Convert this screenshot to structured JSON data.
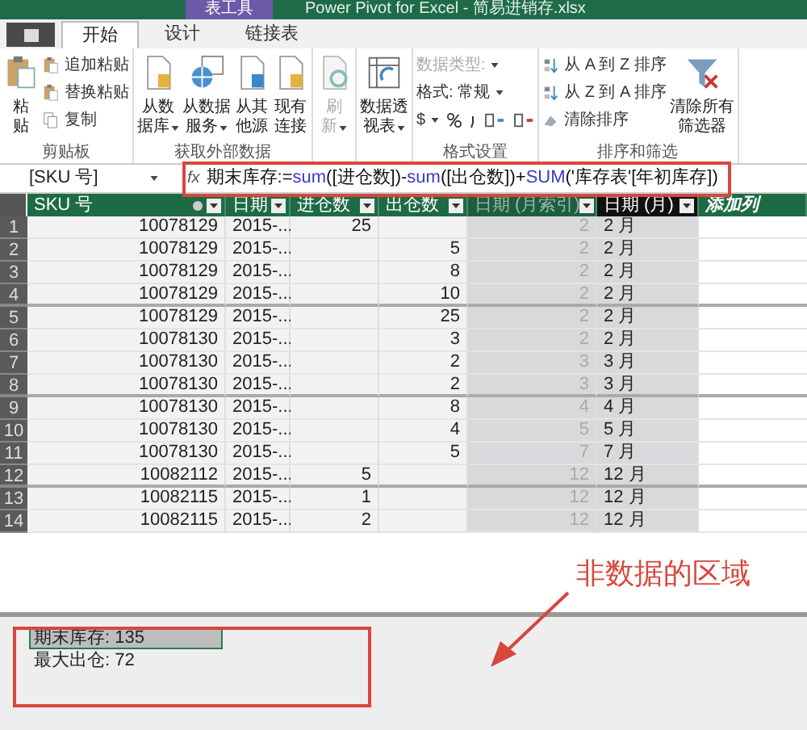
{
  "window": {
    "title": "Power Pivot for Excel - 简易进销存.xlsx",
    "context_tab": "表工具"
  },
  "tabs": [
    {
      "label": "开始",
      "selected": true
    },
    {
      "label": "设计",
      "selected": false
    },
    {
      "label": "链接表",
      "selected": false
    }
  ],
  "ribbon": {
    "groups": [
      {
        "label": "剪贴板",
        "buttons": [
          {
            "kind": "large",
            "lines": [
              "粘",
              "贴"
            ],
            "dropdown": false,
            "disabled": false
          },
          {
            "kind": "small",
            "lines": [
              "追加粘贴"
            ],
            "dropdown": false,
            "disabled": false
          },
          {
            "kind": "small",
            "lines": [
              "替换粘贴"
            ],
            "dropdown": false,
            "disabled": false
          },
          {
            "kind": "small",
            "lines": [
              "复制"
            ],
            "dropdown": false,
            "disabled": false
          }
        ]
      },
      {
        "label": "获取外部数据",
        "buttons": [
          {
            "kind": "large",
            "lines": [
              "从数",
              "据库"
            ],
            "dropdown": true,
            "disabled": false
          },
          {
            "kind": "large",
            "lines": [
              "从数据",
              "服务"
            ],
            "dropdown": true,
            "disabled": false
          },
          {
            "kind": "large",
            "lines": [
              "从其",
              "他源"
            ],
            "dropdown": false,
            "disabled": false
          },
          {
            "kind": "large",
            "lines": [
              "现有",
              "连接"
            ],
            "dropdown": false,
            "disabled": false
          }
        ]
      },
      {
        "buttons": [
          {
            "kind": "large",
            "lines": [
              "刷",
              "新"
            ],
            "dropdown": true,
            "disabled": true
          }
        ]
      },
      {
        "buttons": [
          {
            "kind": "large",
            "lines": [
              "数据透",
              "视表"
            ],
            "dropdown": true,
            "disabled": false
          }
        ]
      },
      {
        "label": "格式设置",
        "buttons": [
          {
            "kind": "small",
            "lines": [
              "数据类型:"
            ],
            "dropdown": true,
            "disabled": true
          },
          {
            "kind": "small",
            "lines": [
              "格式: 常规"
            ],
            "dropdown": true,
            "disabled": false
          },
          {
            "kind": "format",
            "lines": [
              "$"
            ],
            "dropdown": true,
            "disabled": false
          }
        ]
      },
      {
        "label": "排序和筛选",
        "buttons": [
          {
            "kind": "small",
            "lines": [
              "从 A 到 Z 排序"
            ],
            "dropdown": false,
            "disabled": false
          },
          {
            "kind": "small",
            "lines": [
              "从 Z 到 A 排序"
            ],
            "dropdown": false,
            "disabled": false
          },
          {
            "kind": "small",
            "lines": [
              "清除排序"
            ],
            "dropdown": false,
            "disabled": false
          },
          {
            "kind": "large",
            "lines": [
              "清除所有",
              "筛选器"
            ],
            "dropdown": false,
            "disabled": false
          }
        ]
      }
    ]
  },
  "formula_bar": {
    "name_box": "[SKU 号]",
    "function_button": "fx",
    "tokens": [
      {
        "text": "期末库存:=",
        "kind": "text"
      },
      {
        "text": "sum",
        "kind": "function"
      },
      {
        "text": "([进仓数])-",
        "kind": "text"
      },
      {
        "text": "sum",
        "kind": "function"
      },
      {
        "text": "([出仓数])+",
        "kind": "text"
      },
      {
        "text": "SUM",
        "kind": "function"
      },
      {
        "text": "('库存表'[年初库存])",
        "kind": "text"
      }
    ]
  },
  "table": {
    "columns": [
      {
        "label": "SKU 号",
        "selected": false,
        "kind": "data"
      },
      {
        "label": "日期",
        "selected": false,
        "kind": "data"
      },
      {
        "label": "进仓数",
        "selected": false,
        "kind": "data"
      },
      {
        "label": "出仓数",
        "selected": false,
        "kind": "data"
      },
      {
        "label": "日期 (月索引)",
        "selected": false,
        "kind": "hidden"
      },
      {
        "label": "日期 (月)",
        "selected": true,
        "kind": "data"
      },
      {
        "label": "添加列",
        "selected": false,
        "kind": "add"
      }
    ],
    "rows": [
      {
        "number": "1",
        "cells": [
          "10078129",
          "2015-...",
          "25",
          "",
          "2",
          "2 月"
        ]
      },
      {
        "number": "2",
        "cells": [
          "10078129",
          "2015-...",
          "",
          "5",
          "2",
          "2 月"
        ]
      },
      {
        "number": "3",
        "cells": [
          "10078129",
          "2015-...",
          "",
          "8",
          "2",
          "2 月"
        ]
      },
      {
        "number": "4",
        "cells": [
          "10078129",
          "2015-...",
          "",
          "10",
          "2",
          "2 月"
        ]
      },
      {
        "number": "5",
        "cells": [
          "10078129",
          "2015-...",
          "",
          "25",
          "2",
          "2 月"
        ]
      },
      {
        "number": "6",
        "cells": [
          "10078130",
          "2015-...",
          "",
          "3",
          "2",
          "2 月"
        ]
      },
      {
        "number": "7",
        "cells": [
          "10078130",
          "2015-...",
          "",
          "2",
          "3",
          "3 月"
        ]
      },
      {
        "number": "8",
        "cells": [
          "10078130",
          "2015-...",
          "",
          "2",
          "3",
          "3 月"
        ]
      },
      {
        "number": "9",
        "cells": [
          "10078130",
          "2015-...",
          "",
          "8",
          "4",
          "4 月"
        ]
      },
      {
        "number": "10",
        "cells": [
          "10078130",
          "2015-...",
          "",
          "4",
          "5",
          "5 月"
        ]
      },
      {
        "number": "11",
        "cells": [
          "10078130",
          "2015-...",
          "",
          "5",
          "7",
          "7 月"
        ]
      },
      {
        "number": "12",
        "cells": [
          "10082112",
          "2015-...",
          "5",
          "",
          "12",
          "12 月"
        ]
      },
      {
        "number": "13",
        "cells": [
          "10082115",
          "2015-...",
          "1",
          "",
          "12",
          "12 月"
        ]
      },
      {
        "number": "14",
        "cells": [
          "10082115",
          "2015-...",
          "2",
          "",
          "12",
          "12 月"
        ]
      }
    ]
  },
  "calculation_area": [
    {
      "text": "期末库存: 135",
      "selected": true
    },
    {
      "text": "最大出仓: 72",
      "selected": false
    }
  ],
  "annotation": {
    "text": "非数据的区域"
  }
}
